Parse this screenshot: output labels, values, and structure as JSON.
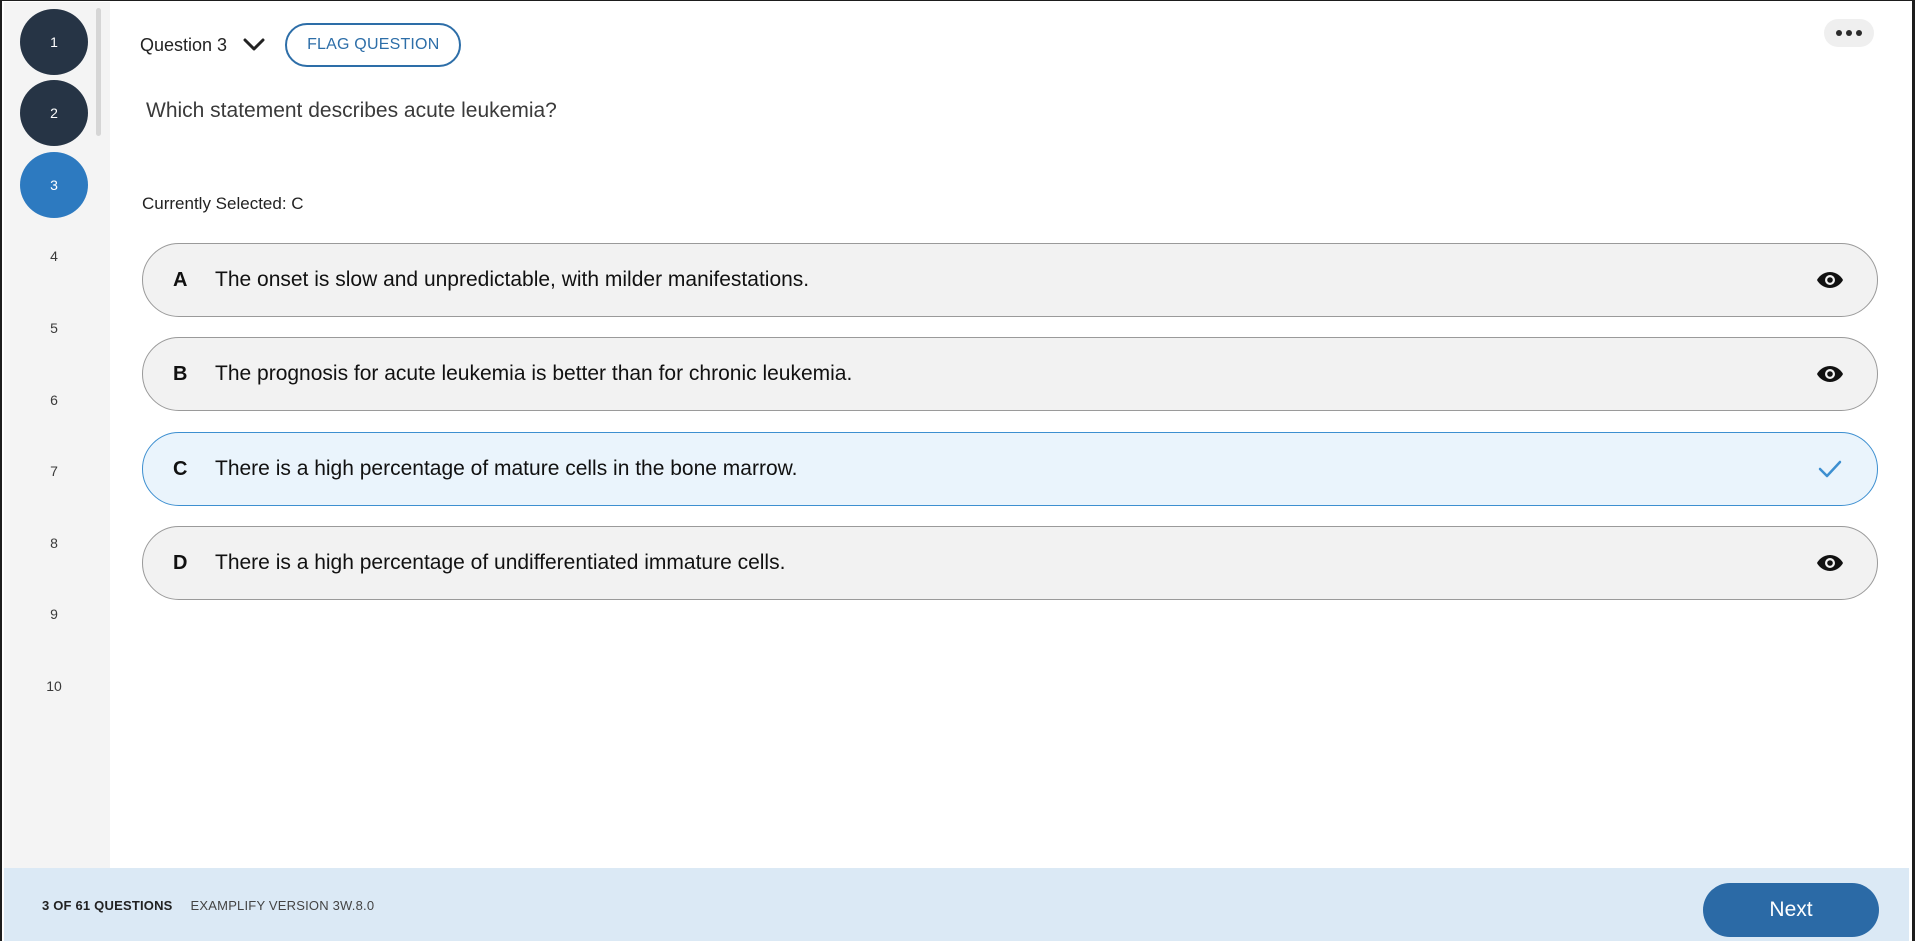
{
  "sidebar": {
    "questions": [
      {
        "label": "1",
        "state": "done"
      },
      {
        "label": "2",
        "state": "done"
      },
      {
        "label": "3",
        "state": "current"
      },
      {
        "label": "4",
        "state": "unvisited"
      },
      {
        "label": "5",
        "state": "unvisited"
      },
      {
        "label": "6",
        "state": "unvisited"
      },
      {
        "label": "7",
        "state": "unvisited"
      },
      {
        "label": "8",
        "state": "unvisited"
      },
      {
        "label": "9",
        "state": "unvisited"
      },
      {
        "label": "10",
        "state": "unvisited"
      }
    ]
  },
  "header": {
    "question_title": "Question 3",
    "flag_label": "FLAG QUESTION"
  },
  "question": {
    "stem": "Which statement describes acute leukemia?",
    "currently_selected": "Currently Selected: C",
    "answers": [
      {
        "letter": "A",
        "text": "The onset is slow and unpredictable, with milder manifestations.",
        "selected": false,
        "icon": "eye-icon"
      },
      {
        "letter": "B",
        "text": "The prognosis for acute leukemia is better than for chronic leukemia.",
        "selected": false,
        "icon": "eye-icon"
      },
      {
        "letter": "C",
        "text": "There is a high percentage of mature cells in the bone marrow.",
        "selected": true,
        "icon": "check-icon"
      },
      {
        "letter": "D",
        "text": "There is a high percentage of undifferentiated immature cells.",
        "selected": false,
        "icon": "eye-icon"
      }
    ]
  },
  "footer": {
    "count": "3 OF 61 QUESTIONS",
    "version": "EXAMPLIFY VERSION 3W.8.0",
    "next_label": "Next"
  },
  "colors": {
    "done": "#263445",
    "current": "#2d7ac0",
    "accent": "#2b6aa6",
    "selected_border": "#3d8fd0",
    "footer_bg": "#dbe9f5"
  }
}
